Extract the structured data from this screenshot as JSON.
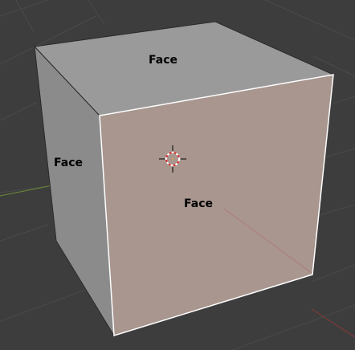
{
  "viewport": {
    "background": "#3d3d3d",
    "grid_color": "#4a4a4a",
    "x_axis_color": "#8b3a3a",
    "y_axis_color": "#6b8a3a"
  },
  "cube": {
    "top_face_color": "#9a9a9a",
    "left_face_color": "#8a8a8a",
    "front_face_color": "#a8968f",
    "selected_edge_color": "#ffffff",
    "labels": {
      "top": "Face",
      "left": "Face",
      "front": "Face"
    }
  },
  "cursor": {
    "name": "3d-cursor-icon"
  }
}
